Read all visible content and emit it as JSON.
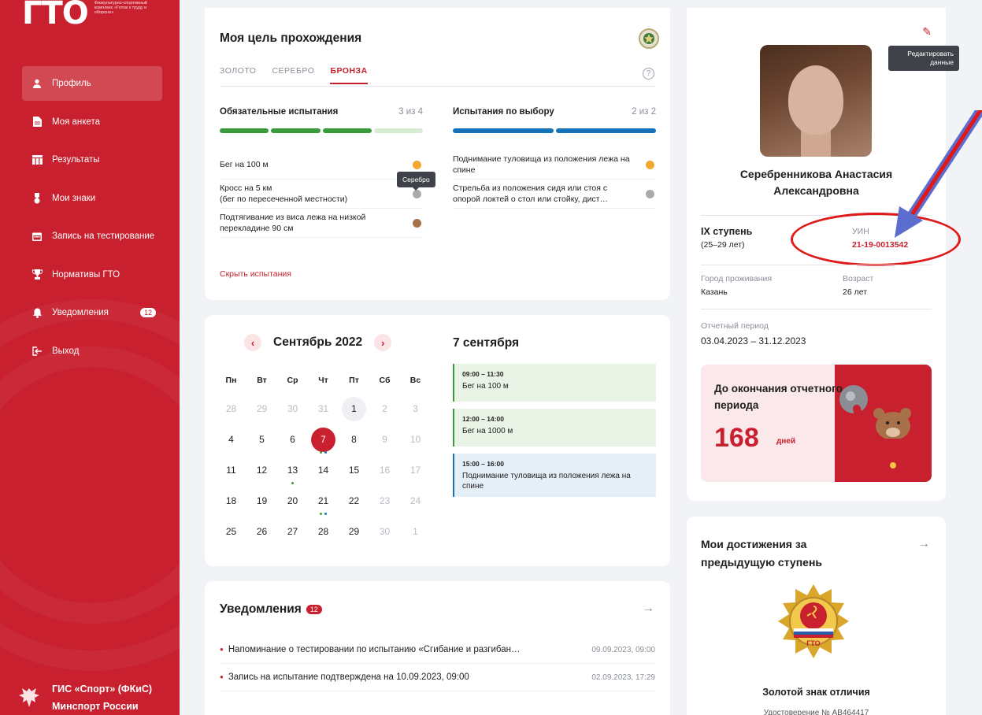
{
  "sidebar": {
    "logo_mark": "ГТО",
    "logo_text": "Физкультурно-спортивный комплекс «Готов к труду и обороне»",
    "items": [
      {
        "label": "Профиль",
        "icon": "user-icon",
        "active": true
      },
      {
        "label": "Моя анкета",
        "icon": "document-icon"
      },
      {
        "label": "Результаты",
        "icon": "table-icon"
      },
      {
        "label": "Мои знаки",
        "icon": "medal-icon"
      },
      {
        "label": "Запись на тестирование",
        "icon": "calendar-icon"
      },
      {
        "label": "Нормативы ГТО",
        "icon": "trophy-icon"
      },
      {
        "label": "Уведомления",
        "icon": "bell-icon",
        "badge": "12"
      },
      {
        "label": "Выход",
        "icon": "logout-icon"
      }
    ],
    "footer_line1": "ГИС «Спорт» (ФКиС)",
    "footer_line2": "Минспорт России"
  },
  "goal": {
    "title": "Моя цель прохождения",
    "tabs": [
      "ЗОЛОТО",
      "СЕРЕБРО",
      "БРОНЗА"
    ],
    "active_tab": "БРОНЗА",
    "mandatory": {
      "label": "Обязательные испытания",
      "count": "3 из 4",
      "done": 3,
      "total": 4,
      "items": [
        {
          "name": "Бег на 100 м",
          "medal": "gold"
        },
        {
          "name": "Кросс на 5 км\n(бег по пересеченной местности)",
          "medal": "silver"
        },
        {
          "name": "Подтягивание из виса лежа на низкой перекладине 90 см",
          "medal": "bronze"
        }
      ]
    },
    "optional": {
      "label": "Испытания по выбору",
      "count": "2 из 2",
      "done": 2,
      "total": 2,
      "items": [
        {
          "name": "Поднимание туловища из положения лежа на спине",
          "medal": "gold"
        },
        {
          "name": "Стрельба из положения сидя или стоя с опорой локтей о стол или стойку, дист…",
          "medal": "silver"
        }
      ]
    },
    "tooltip": "Серебро",
    "hide_link": "Скрыть испытания"
  },
  "calendar": {
    "month": "Сентябрь 2022",
    "day_names": [
      "Пн",
      "Вт",
      "Ср",
      "Чт",
      "Пт",
      "Сб",
      "Вс"
    ],
    "weeks": [
      [
        "28",
        "29",
        "30",
        "31",
        "1",
        "2",
        "3"
      ],
      [
        "4",
        "5",
        "6",
        "7",
        "8",
        "9",
        "10"
      ],
      [
        "11",
        "12",
        "13",
        "14",
        "15",
        "16",
        "17"
      ],
      [
        "18",
        "19",
        "20",
        "21",
        "22",
        "23",
        "24"
      ],
      [
        "25",
        "26",
        "27",
        "28",
        "29",
        "30",
        "1"
      ]
    ],
    "selected_date": "7 сентября",
    "events": [
      {
        "time": "09:00 – 11:30",
        "title": "Бег на 100 м",
        "kind": "green"
      },
      {
        "time": "12:00 – 14:00",
        "title": "Бег на 1000 м",
        "kind": "green"
      },
      {
        "time": "15:00 – 16:00",
        "title": "Поднимание туловища из положения лежа на спине",
        "kind": "blue"
      }
    ]
  },
  "notifications": {
    "title": "Уведомления",
    "badge": "12",
    "items": [
      {
        "text": "Напоминание о тестировании по испытанию «Сгибание и разгибан…",
        "date": "09.09.2023, 09:00"
      },
      {
        "text": "Запись на испытание подтверждена на 10.09.2023, 09:00",
        "date": "02.09.2023, 17:29"
      }
    ]
  },
  "profile": {
    "edit_tooltip": "Редактировать данные",
    "name": "Серебренникова Анастасия Александровна",
    "level": "IX ступень",
    "level_age": "(25–29 лет)",
    "uin_label": "УИН",
    "uin": "21-19-0013542",
    "city_label": "Город проживания",
    "city": "Казань",
    "age_label": "Возраст",
    "age": "26 лет",
    "period_label": "Отчетный период",
    "period": "03.04.2023 – 31.12.2023",
    "countdown_label": "До окончания отчетного периода",
    "countdown_days": "168",
    "countdown_unit": "дней"
  },
  "achievements": {
    "title": "Мои достижения за предыдущую ступень",
    "medal_title": "Золотой знак отличия",
    "medal_text": "ГТО",
    "certificate": "Удостоверение № АВ464417"
  },
  "colors": {
    "brand_red": "#c8202e",
    "green": "#3a9b3a",
    "blue": "#1673b8",
    "gold": "#f0a830",
    "silver": "#aaaaaa",
    "bronze": "#a8714a"
  }
}
